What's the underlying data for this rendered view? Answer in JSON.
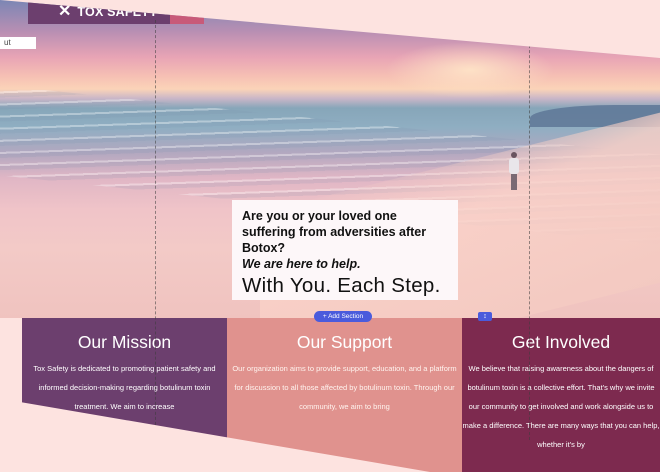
{
  "header": {
    "brand": "TOX SAFETY"
  },
  "side_tab": {
    "label": "ut"
  },
  "hero": {
    "question": "Are you or your loved one suffering from adversities after Botox?",
    "emphasis": "We are here to help.",
    "tagline": "With You. Each Step."
  },
  "editor": {
    "add_section_label": "+ Add Section",
    "handle_label": "↕"
  },
  "columns": [
    {
      "title": "Our Mission",
      "text": "Tox Safety is dedicated to promoting patient safety and informed decision-making regarding botulinum toxin treatment. We aim to increase"
    },
    {
      "title": "Our Support",
      "text": "Our organization aims to provide support, education, and a platform for discussion to all those affected by botulinum toxin. Through our community, we aim to bring"
    },
    {
      "title": "Get Involved",
      "text": "We believe that raising awareness about the dangers of botulinum toxin is a collective effort. That's why we invite our community to get involved and work alongside us to make a difference. There are many ways that you can help, whether it's by"
    }
  ],
  "colors": {
    "mission": "#6c3f6e",
    "support": "#e0928e",
    "involved": "#7d2a4f",
    "editor_accent": "#4a5bdc",
    "background": "#fde3e0"
  }
}
